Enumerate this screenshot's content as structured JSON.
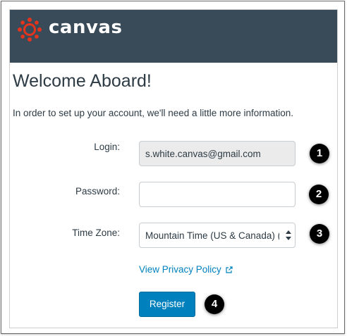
{
  "header": {
    "logo_text": "canvas",
    "logo_icon": "canvas-logo-icon",
    "bg_color": "#394b58"
  },
  "page": {
    "title": "Welcome Aboard!",
    "intro": "In order to set up your account, we'll need a little more information."
  },
  "form": {
    "login_label": "Login:",
    "login_value": "s.white.canvas@gmail.com",
    "password_label": "Password:",
    "password_value": "",
    "timezone_label": "Time Zone:",
    "timezone_value": "Mountain Time (US & Canada) (-",
    "privacy_link": "View Privacy Policy",
    "register_label": "Register"
  },
  "callouts": [
    "1",
    "2",
    "3",
    "4"
  ],
  "colors": {
    "accent": "#0081bd",
    "logo_red": "#e4341d"
  }
}
